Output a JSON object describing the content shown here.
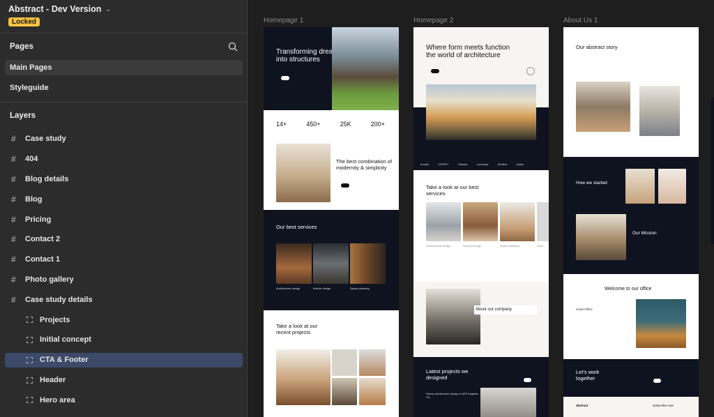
{
  "project": {
    "title": "Abstract - Dev Version",
    "badge": "Locked"
  },
  "pages_section": {
    "title": "Pages",
    "items": [
      "Main Pages",
      "Styleguide"
    ]
  },
  "layers_section": {
    "title": "Layers",
    "frames": [
      "Case study",
      "404",
      "Blog details",
      "Blog",
      "Pricing",
      "Contact 2",
      "Contact 1",
      "Photo gallery",
      "Case study details"
    ],
    "children": [
      "Projects",
      "Initial concept",
      "CTA & Footer",
      "Header",
      "Hero area"
    ]
  },
  "canvas": {
    "frame_labels": [
      "Homepage 1",
      "Homepage 2",
      "About Us 1"
    ],
    "homepage1": {
      "hero_title": "Transforming dreams into structures",
      "stats": [
        "14+",
        "450+",
        "25K",
        "200+"
      ],
      "combo_title": "The best combination of modernity & simplicity",
      "services_title": "Our best services",
      "services": [
        "Architecture design",
        "Interior design",
        "Space planning"
      ],
      "projects_title": "Take a look at our recent projects"
    },
    "homepage2": {
      "hero_title": "Where form meets function the world of architecture",
      "logos": [
        "envato",
        "CRISPY",
        "Dubsas",
        "Lumessa",
        "Zenitha",
        "Opalo"
      ],
      "services_title": "Take a look at our best services",
      "services": [
        "Architectural design",
        "Interior Design",
        "Space planning",
        "Deco"
      ],
      "about_title": "About our company",
      "latest_title": "Latest projects we designed",
      "latest_sub": "House architecture design in AST Angeles, CA"
    },
    "about1": {
      "story_title": "Our abstract story",
      "started_title": "How we started",
      "mission_title": "Our Mission",
      "office_title": "Welcome to our office",
      "office_label": "Head Office",
      "cta_title": "Let's work together",
      "footer_brand": "abstract",
      "footer_subscribe": "Subscribe now"
    }
  },
  "colors": {
    "selected": "#3c4968",
    "locked_badge": "#f5c242",
    "dark_section": "#0f1320"
  }
}
